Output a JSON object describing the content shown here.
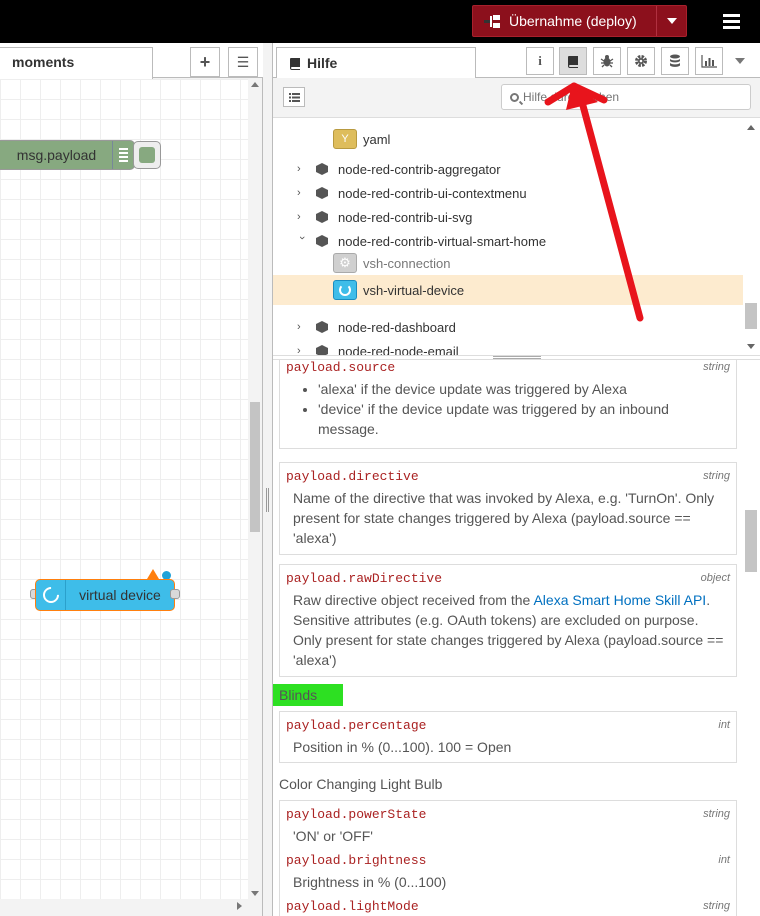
{
  "header": {
    "deploy_label": "Übernahme (deploy)"
  },
  "workspace": {
    "tab_label": "moments",
    "add_icon": "+",
    "list_icon": "☰",
    "nodes": {
      "payload_label": "msg.payload",
      "virtual_device_label": "virtual device"
    }
  },
  "sidebar": {
    "tab_label": "Hilfe",
    "info_icon": "i",
    "search_placeholder": "Hilfe durchsuchen",
    "tree": {
      "yaml": "yaml",
      "aggregator": "node-red-contrib-aggregator",
      "contextmenu": "node-red-contrib-ui-contextmenu",
      "svg": "node-red-contrib-ui-svg",
      "vsh": "node-red-contrib-virtual-smart-home",
      "vsh_connection": "vsh-connection",
      "vsh_device": "vsh-virtual-device",
      "dashboard": "node-red-dashboard",
      "email": "node-red-node-email"
    },
    "help": {
      "source": {
        "name": "payload.source",
        "type": "string",
        "items": [
          "'alexa' if the device update was triggered by Alexa",
          "'device' if the device update was triggered by an inbound message."
        ]
      },
      "directive": {
        "name": "payload.directive",
        "type": "string",
        "desc": "Name of the directive that was invoked by Alexa, e.g. 'TurnOn'. Only present for state changes triggered by Alexa (payload.source == 'alexa')"
      },
      "rawDirective": {
        "name": "payload.rawDirective",
        "type": "object",
        "desc_before": "Raw directive object received from the ",
        "link": "Alexa Smart Home Skill API",
        "desc_after": ". Sensitive attributes (e.g. OAuth tokens) are excluded on purpose. Only present for state changes triggered by Alexa (payload.source == 'alexa')"
      },
      "blinds_title": "Blinds",
      "percentage": {
        "name": "payload.percentage",
        "type": "int",
        "desc": "Position in % (0...100). 100 = Open"
      },
      "bulb_title": "Color Changing Light Bulb",
      "powerState": {
        "name": "payload.powerState",
        "type": "string",
        "desc": "'ON' or 'OFF'"
      },
      "brightness": {
        "name": "payload.brightness",
        "type": "int",
        "desc": "Brightness in % (0...100)"
      },
      "lightMode": {
        "name": "payload.lightMode",
        "type": "string"
      }
    }
  },
  "colors": {
    "deploy": "#8c101c",
    "highlight": "#2de022",
    "arrow": "#e8141c",
    "selected_row": "#fdebcf"
  }
}
